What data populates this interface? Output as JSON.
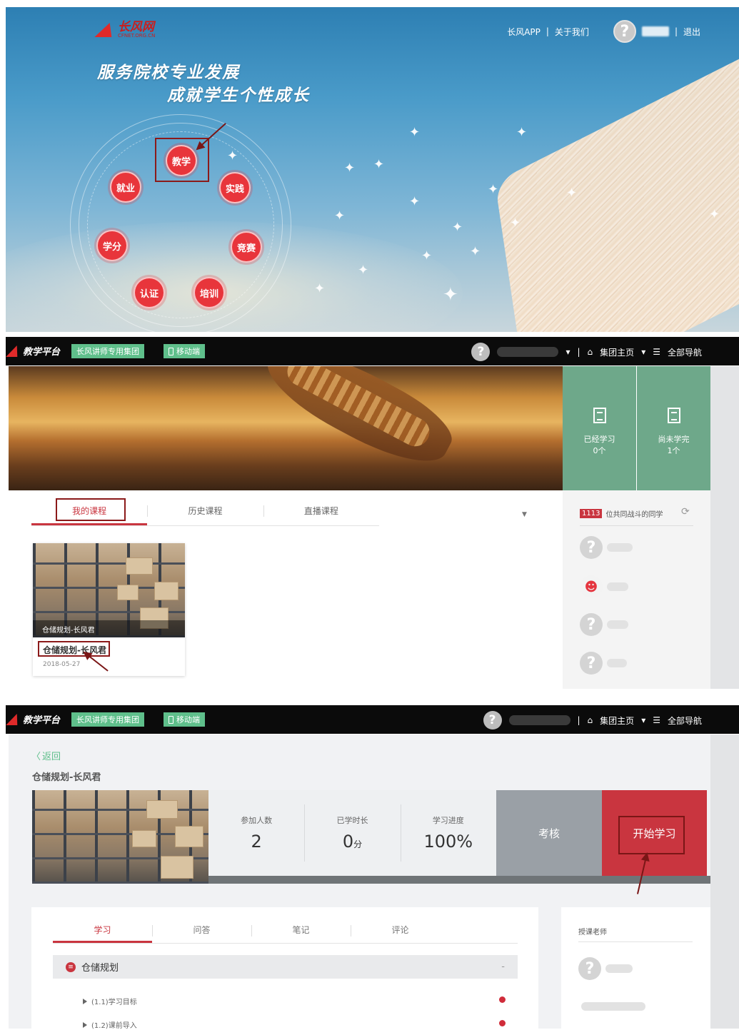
{
  "hero": {
    "logo_name": "长风网",
    "logo_sub": "CFNET.ORG.CN",
    "slogan_line1": "服务院校专业发展",
    "slogan_line2": "成就学生个性成长",
    "links": {
      "app": "长风APP",
      "sep1": "|",
      "about": "关于我们",
      "sep2": "|",
      "logout": "退出"
    },
    "avatar_glyph": "?",
    "nodes": {
      "teach": "教学",
      "job": "就业",
      "practice": "实践",
      "credit": "学分",
      "contest": "竞赛",
      "cert": "认证",
      "train": "培训"
    }
  },
  "topbar": {
    "logo_text": "教学平台",
    "group_btn": "长风讲师专用集团",
    "mobile_btn": "移动端",
    "avatar_glyph": "?",
    "home": "集团主页",
    "nav": "全部导航",
    "sep": "|"
  },
  "course_list": {
    "stats": [
      {
        "label": "已经学习",
        "value": "0个"
      },
      {
        "label": "尚未学完",
        "value": "1个"
      }
    ],
    "tabs": [
      "我的课程",
      "历史课程",
      "直播课程"
    ],
    "card": {
      "overlay_title": "仓储规划-长风君",
      "title": "仓储规划-长风君",
      "date": "2018-05-27"
    },
    "classmates": {
      "count": "1113",
      "text": "位共同战斗的同学"
    },
    "avatar_glyph": "?"
  },
  "detail": {
    "back": "返回",
    "title": "仓储规划-长风君",
    "stats": [
      {
        "label": "参加人数",
        "value": "2",
        "unit": ""
      },
      {
        "label": "已学时长",
        "value": "0",
        "unit": "分"
      },
      {
        "label": "学习进度",
        "value": "100%",
        "unit": ""
      }
    ],
    "exam_btn": "考核",
    "start_btn": "开始学习",
    "tabs": [
      "学习",
      "问答",
      "笔记",
      "评论"
    ],
    "chapter": {
      "title": "仓储规划",
      "toggle": "-"
    },
    "lessons": [
      "(1.1)学习目标",
      "(1.2)课前导入"
    ],
    "teacher_label": "授课老师",
    "avatar_glyph": "?"
  },
  "colors": {
    "accent": "#c9353f",
    "green": "#5fbf8b",
    "stat_green": "#6ea88a",
    "topbar": "#0b0b0b"
  }
}
